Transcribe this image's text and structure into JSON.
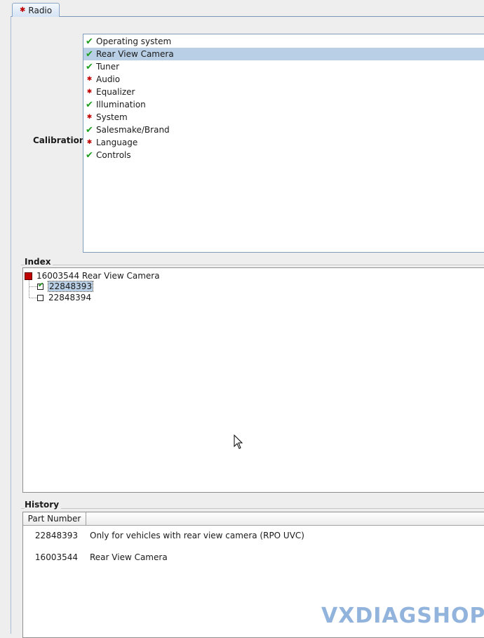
{
  "tab": {
    "label": "Radio"
  },
  "calibration": {
    "label": "Calibration",
    "items": [
      {
        "label": "Operating system",
        "status": "ok"
      },
      {
        "label": "Rear View Camera",
        "status": "ok",
        "selected": true
      },
      {
        "label": "Tuner",
        "status": "ok"
      },
      {
        "label": "Audio",
        "status": "missing"
      },
      {
        "label": "Equalizer",
        "status": "missing"
      },
      {
        "label": "Illumination",
        "status": "ok"
      },
      {
        "label": "System",
        "status": "missing"
      },
      {
        "label": "Salesmake/Brand",
        "status": "ok"
      },
      {
        "label": "Language",
        "status": "missing"
      },
      {
        "label": "Controls",
        "status": "ok"
      }
    ]
  },
  "index": {
    "title": "Index",
    "root": "16003544 Rear View Camera",
    "children": [
      {
        "label": "22848393",
        "checked": true,
        "selected": true
      },
      {
        "label": "22848394",
        "checked": false,
        "selected": false
      }
    ]
  },
  "history": {
    "title": "History",
    "column": "Part Number",
    "rows": [
      {
        "part": "22848393",
        "description": "Only for vehicles with rear view camera (RPO UVC)"
      },
      {
        "part": "16003544",
        "description": "Rear View Camera"
      }
    ]
  },
  "watermark": "VXDIAGSHOP",
  "colors": {
    "ok": "#1e9e1e",
    "missing": "#c00000",
    "selection": "#b8cfe5"
  }
}
